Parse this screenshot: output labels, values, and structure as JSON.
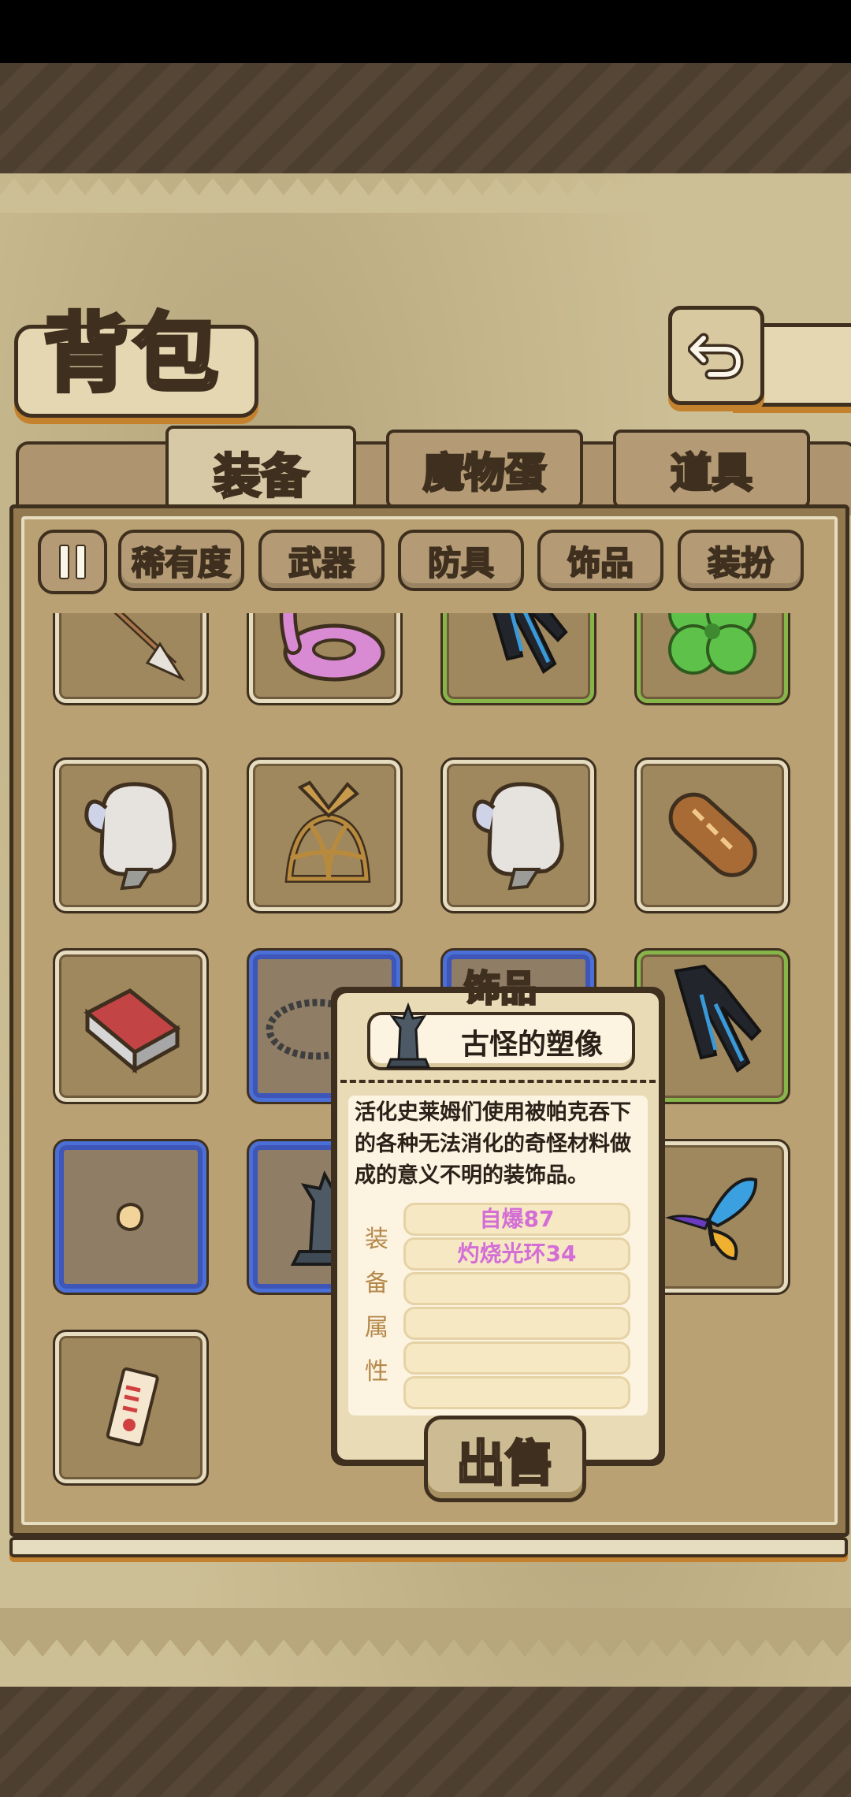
{
  "header": {
    "title": "背包"
  },
  "tabs": [
    {
      "label": "装备",
      "active": true
    },
    {
      "label": "魔物蛋",
      "active": false
    },
    {
      "label": "道具",
      "active": false
    }
  ],
  "filters": [
    "稀有度",
    "武器",
    "防具",
    "饰品",
    "装扮"
  ],
  "inventory": {
    "rows": [
      [
        "arrow-icon",
        "pink-swim-ring-icon",
        "black-glove-icon",
        "four-leaf-clover-icon"
      ],
      [
        "white-mitten-icon",
        "wooden-propeller-hat-icon",
        "white-mitten-icon",
        "bread-loaf-icon"
      ],
      [
        "red-brick-icon",
        "rope-coil-icon",
        "blue-slot-item-icon",
        "black-glove-icon"
      ],
      [
        "small-pebble-icon",
        "strange-statue-icon",
        "hidden-item-icon",
        "butterfly-icon"
      ],
      [
        "paper-charm-icon"
      ]
    ],
    "rarity": [
      [
        "common",
        "common",
        "green",
        "green"
      ],
      [
        "common",
        "common",
        "common",
        "common"
      ],
      [
        "common",
        "blue",
        "blue",
        "green"
      ],
      [
        "blue",
        "blue",
        "common",
        "common"
      ],
      [
        "common"
      ]
    ]
  },
  "popup": {
    "category": "饰品",
    "item_name": "古怪的塑像",
    "item_icon": "statue-icon",
    "description": "活化史莱姆们使用被帕克吞下的各种无法消化的奇怪材料做成的意义不明的装饰品。",
    "attribute_label": [
      "装",
      "备",
      "属",
      "性"
    ],
    "attributes": [
      "自爆87",
      "灼烧光环34",
      "",
      "",
      "",
      ""
    ],
    "attribute_color": "#d36ed6",
    "sell_label": "出售"
  },
  "colors": {
    "outline": "#3e2f1e",
    "parchment": "#cdbf95",
    "rarity_green": "#86b54a",
    "rarity_blue": "#4a6fd6"
  }
}
